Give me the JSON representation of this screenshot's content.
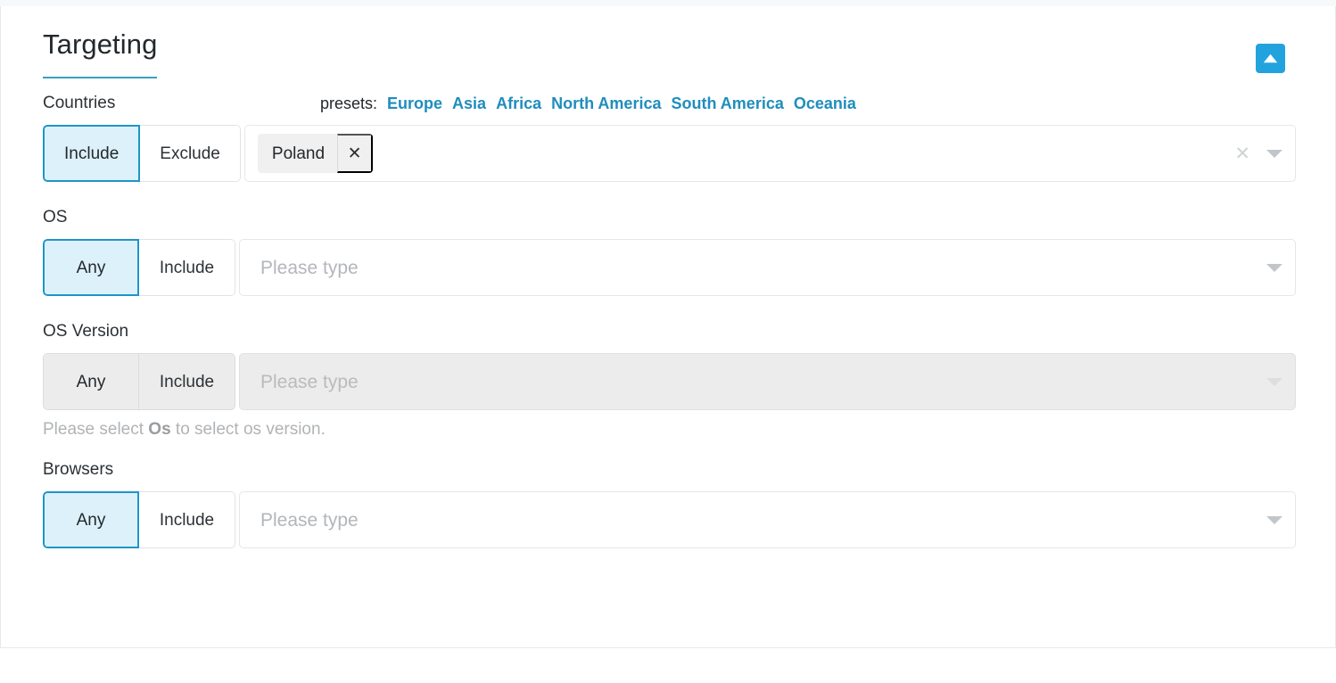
{
  "header": {
    "title": "Targeting",
    "collapse_icon": "triangle-up-icon",
    "collapse_color": "#22a3dd",
    "accent_underline": "#39a0bd"
  },
  "presets": {
    "label": "presets:",
    "items": [
      {
        "label": "Europe"
      },
      {
        "label": "Asia"
      },
      {
        "label": "Africa"
      },
      {
        "label": "North America"
      },
      {
        "label": "South America"
      },
      {
        "label": "Oceania"
      }
    ],
    "link_color": "#1f8dbd"
  },
  "fields": {
    "countries": {
      "label": "Countries",
      "toggles": [
        {
          "label": "Include",
          "active": true
        },
        {
          "label": "Exclude",
          "active": false
        }
      ],
      "tags": [
        {
          "label": "Poland",
          "remove_icon": "close-icon"
        }
      ],
      "clear_icon": "close-icon",
      "caret_icon": "chevron-down-icon",
      "disabled": false
    },
    "os": {
      "label": "OS",
      "toggles": [
        {
          "label": "Any",
          "active": true
        },
        {
          "label": "Include",
          "active": false
        }
      ],
      "placeholder": "Please type",
      "caret_icon": "chevron-down-icon",
      "disabled": false
    },
    "os_version": {
      "label": "OS Version",
      "toggles": [
        {
          "label": "Any",
          "active": true
        },
        {
          "label": "Include",
          "active": false
        }
      ],
      "placeholder": "Please type",
      "caret_icon": "chevron-down-icon",
      "disabled": true,
      "helper_prefix": "Please select ",
      "helper_strong": "Os",
      "helper_suffix": " to select os version."
    },
    "browsers": {
      "label": "Browsers",
      "toggles": [
        {
          "label": "Any",
          "active": true
        },
        {
          "label": "Include",
          "active": false
        }
      ],
      "placeholder": "Please type",
      "caret_icon": "chevron-down-icon",
      "disabled": false
    }
  },
  "theme": {
    "active_toggle_bg": "#ddf1fb",
    "active_toggle_border": "#1f95c7",
    "disabled_bg": "#ececec",
    "placeholder_color": "#b3b6ba"
  }
}
